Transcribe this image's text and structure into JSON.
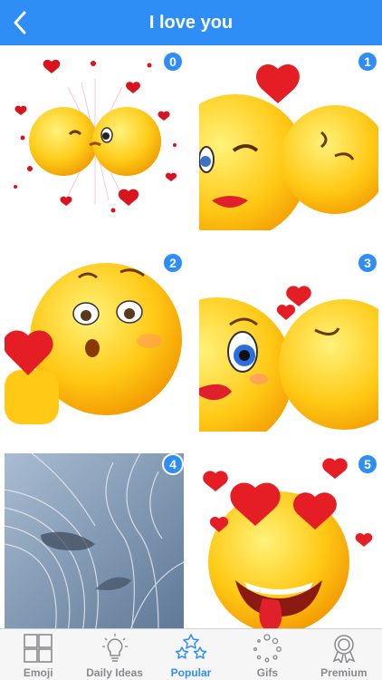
{
  "header": {
    "title": "I love you",
    "back_icon": "chevron-left-icon"
  },
  "stickers": [
    {
      "number": "0",
      "description_icon": "kissing-emoji-pair-icon"
    },
    {
      "number": "1",
      "description_icon": "kiss-on-cheek-emoji-icon"
    },
    {
      "number": "2",
      "description_icon": "blowing-kiss-emoji-icon"
    },
    {
      "number": "3",
      "description_icon": "kiss-emoji-pair-icon"
    },
    {
      "number": "4",
      "description_icon": "kissing-faces-photo-icon"
    },
    {
      "number": "5",
      "description_icon": "love-struck-emoji-icon"
    }
  ],
  "tabs": [
    {
      "label": "Emoji",
      "icon": "grid-icon",
      "active": false
    },
    {
      "label": "Daily Ideas",
      "icon": "lightbulb-icon",
      "active": false
    },
    {
      "label": "Popular",
      "icon": "stars-icon",
      "active": true
    },
    {
      "label": "Gifs",
      "icon": "dots-circle-icon",
      "active": false
    },
    {
      "label": "Premium",
      "icon": "award-ribbon-icon",
      "active": false
    }
  ],
  "colors": {
    "accent": "#2f8ef5",
    "tab_inactive": "#8a8a8e",
    "heart": "#e8202a",
    "emoji_yellow": "#ffcc1a"
  }
}
